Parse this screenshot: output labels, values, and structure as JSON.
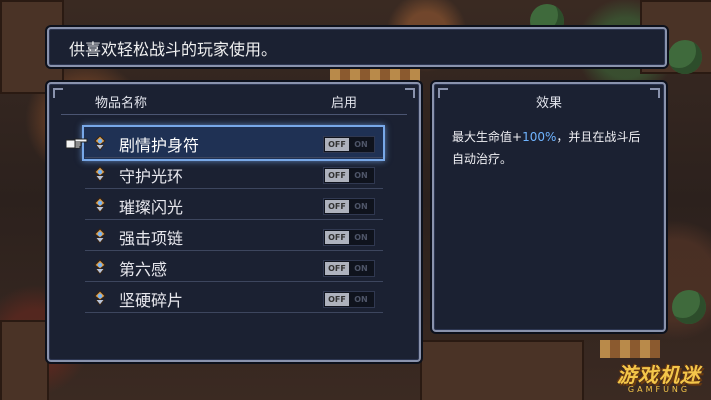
{
  "dialog": {
    "description": "供喜欢轻松战斗的玩家使用。"
  },
  "list": {
    "header_name": "物品名称",
    "header_enabled": "启用",
    "items": [
      {
        "label": "剧情护身符",
        "toggle_off": "OFF",
        "toggle_on": "ON",
        "enabled": false,
        "selected": true
      },
      {
        "label": "守护光环",
        "toggle_off": "OFF",
        "toggle_on": "ON",
        "enabled": false,
        "selected": false
      },
      {
        "label": "璀璨闪光",
        "toggle_off": "OFF",
        "toggle_on": "ON",
        "enabled": false,
        "selected": false
      },
      {
        "label": "强击项链",
        "toggle_off": "OFF",
        "toggle_on": "ON",
        "enabled": false,
        "selected": false
      },
      {
        "label": "第六感",
        "toggle_off": "OFF",
        "toggle_on": "ON",
        "enabled": false,
        "selected": false
      },
      {
        "label": "坚硬碎片",
        "toggle_off": "OFF",
        "toggle_on": "ON",
        "enabled": false,
        "selected": false
      }
    ]
  },
  "effect": {
    "title": "效果",
    "text_before": "最大生命值+",
    "text_highlight": "100%",
    "text_after": "，并且在战斗后自动治疗。"
  },
  "watermark": {
    "main": "游戏机迷",
    "sub": "GAMFUNG"
  },
  "colors": {
    "panel_bg": "#1b2132",
    "panel_border": "#8a93ad",
    "selection": "#78a8e8",
    "highlight_text": "#6fb4ff"
  },
  "icons": {
    "item": "amulet-icon",
    "pointer": "pointing-hand-icon"
  }
}
